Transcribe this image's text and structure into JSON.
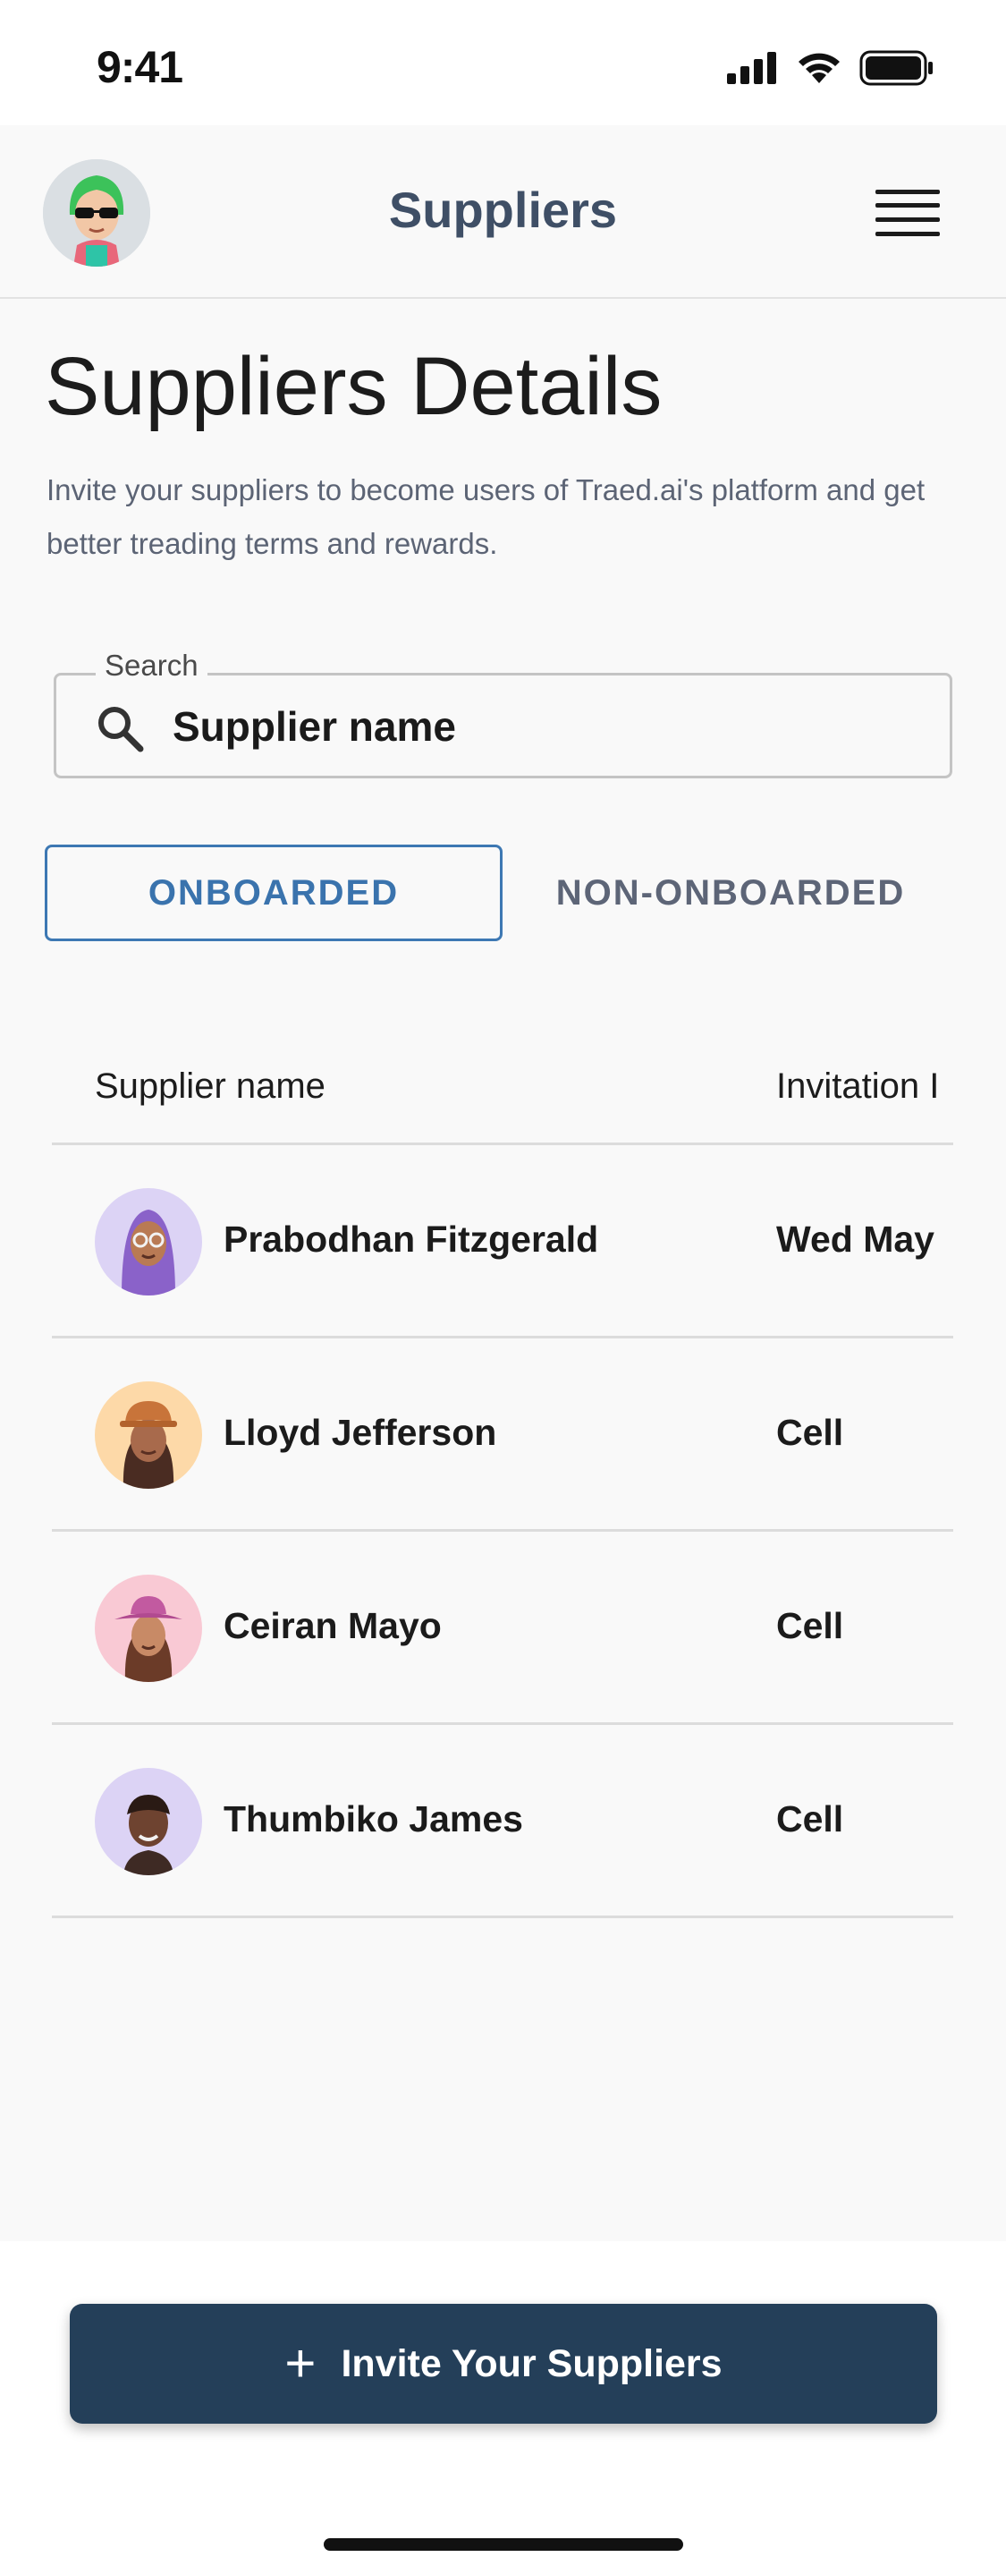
{
  "status_bar": {
    "time": "9:41"
  },
  "header": {
    "title": "Suppliers"
  },
  "page": {
    "title": "Suppliers Details",
    "description": "Invite your suppliers to become users of Traed.ai's platform and get better treading terms and rewards."
  },
  "search": {
    "label": "Search",
    "placeholder": "Supplier name"
  },
  "tabs": {
    "onboarded": "ONBOARDED",
    "non_onboarded": "NON-ONBOARDED"
  },
  "table": {
    "columns": {
      "name": "Supplier name",
      "invitation": "Invitation I"
    },
    "rows": [
      {
        "name": "Prabodhan Fitzgerald",
        "invitation": "Wed May"
      },
      {
        "name": "Lloyd Jefferson",
        "invitation": "Cell"
      },
      {
        "name": "Ceiran Mayo",
        "invitation": "Cell"
      },
      {
        "name": "Thumbiko James",
        "invitation": "Cell"
      }
    ]
  },
  "invite_button": {
    "label": "Invite Your Suppliers"
  },
  "colors": {
    "accent": "#3d78b3",
    "button": "#243f59",
    "header_title": "#3f4f66",
    "avatar_bg_purple": "#dcd3f5",
    "avatar_bg_orange": "#fdd9a8",
    "avatar_bg_pink": "#f9c9d4"
  }
}
